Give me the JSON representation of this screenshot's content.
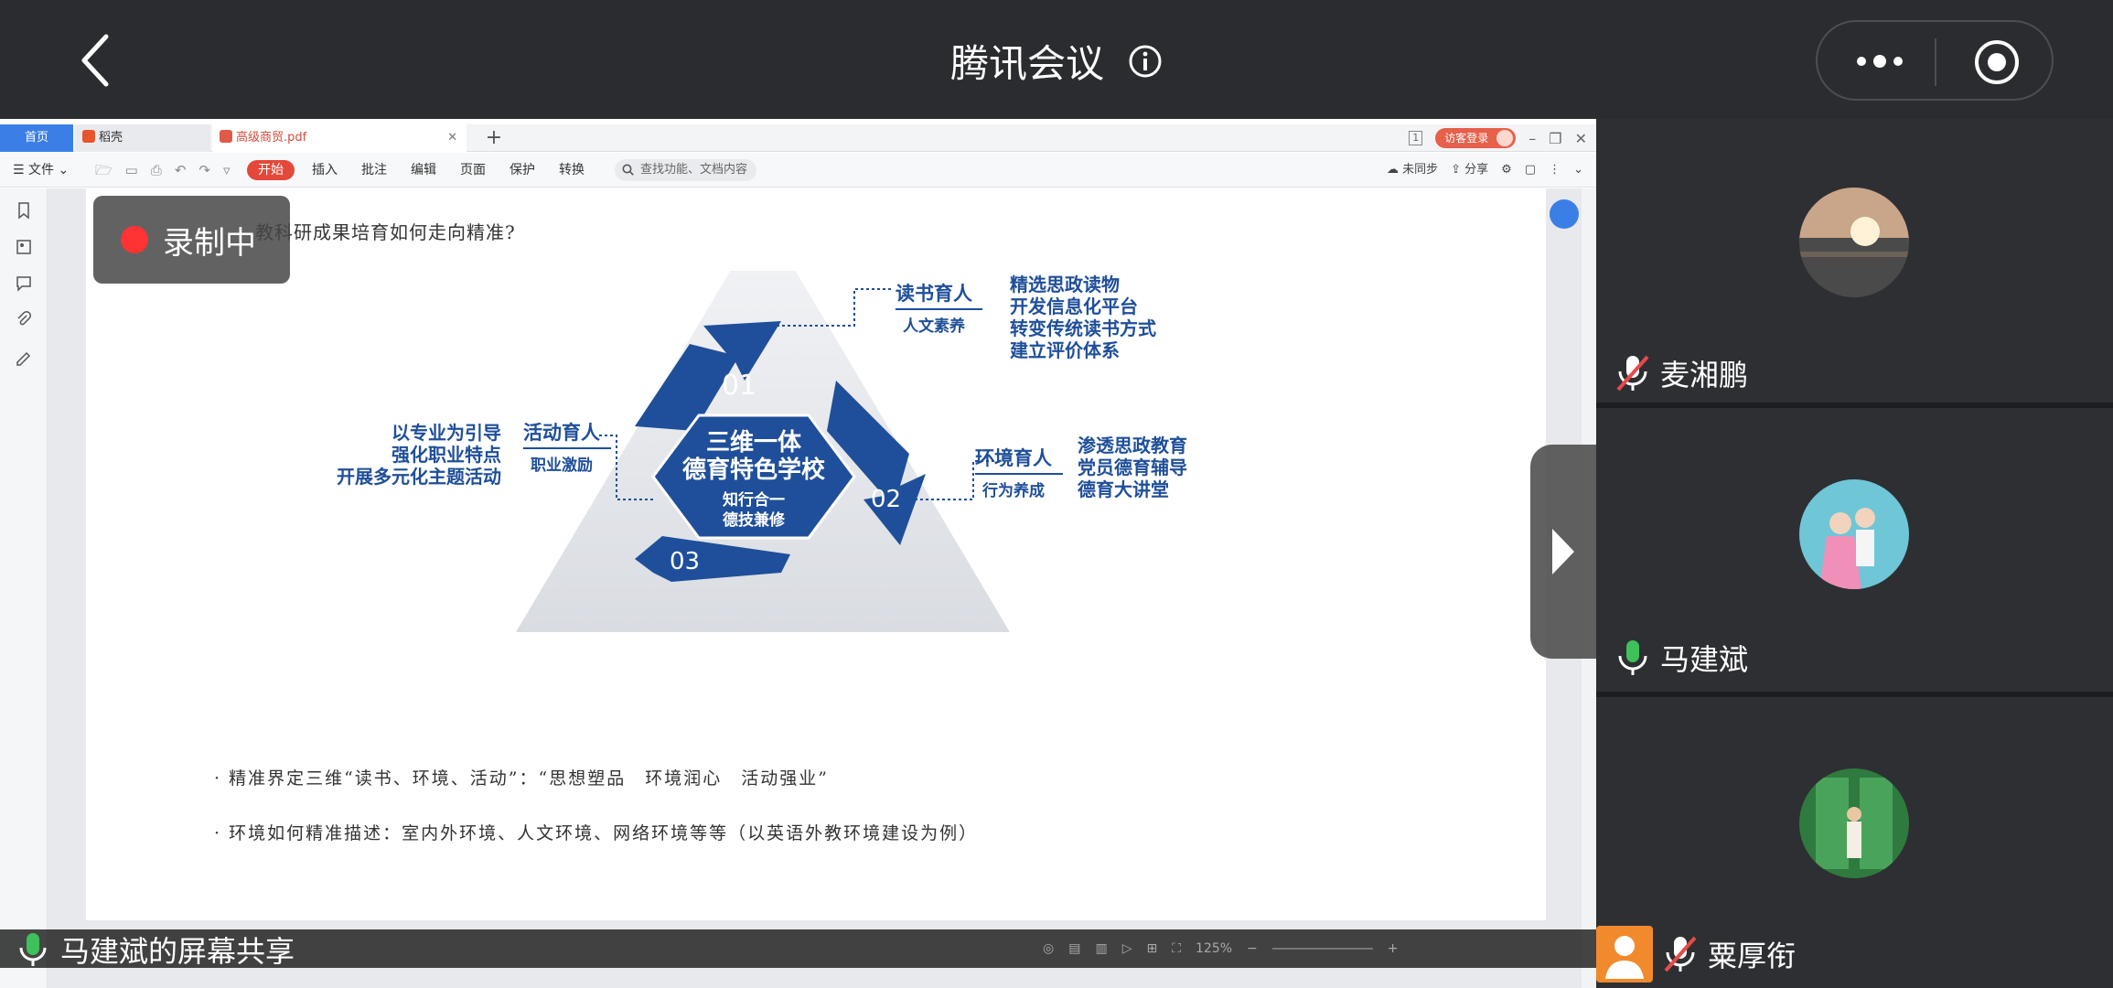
{
  "header": {
    "title": "腾讯会议"
  },
  "wps": {
    "tabs": {
      "home": "首页",
      "docer": "稻壳",
      "pdf": "高级商贸.pdf",
      "add": "+"
    },
    "page_indicator": "1",
    "login": "访客登录",
    "toolbar": {
      "file": "文件",
      "menu": [
        "开始",
        "插入",
        "批注",
        "编辑",
        "页面",
        "保护",
        "转换"
      ],
      "search_placeholder": "查找功能、文档内容",
      "sync": "未同步",
      "share": "分享"
    }
  },
  "document": {
    "title_visible": "教科研成果培育如何走向精准?",
    "diagram": {
      "center_line1": "三维一体",
      "center_line2": "德育特色学校",
      "center_sub1": "知行合一",
      "center_sub2": "德技兼修",
      "n1": "01",
      "n2": "02",
      "n3": "03",
      "read_title": "读书育人",
      "read_sub": "人文素养",
      "read_items": [
        "精选思政读物",
        "开发信息化平台",
        "转变传统读书方式",
        "建立评价体系"
      ],
      "env_title": "环境育人",
      "env_sub": "行为养成",
      "env_items": [
        "渗透思政教育",
        "党员德育辅导",
        "德育大讲堂"
      ],
      "act_title": "活动育人",
      "act_sub": "职业激励",
      "act_items": [
        "以专业为引导",
        "强化职业特点",
        "开展多元化主题活动"
      ]
    },
    "bullets": [
      "· 精准界定三维“读书、环境、活动”：“思想塑品　环境润心　活动强业”",
      "· 环境如何精准描述：室内外环境、人文环境、网络环境等等（以英语外教环境建设为例）"
    ],
    "zoom": "125%"
  },
  "recording": {
    "label": "录制中"
  },
  "share": {
    "label": "马建斌的屏幕共享"
  },
  "participants": [
    {
      "name": "麦湘鹏",
      "mic": "muted"
    },
    {
      "name": "马建斌",
      "mic": "on"
    },
    {
      "name": "粟厚衔",
      "mic": "muted"
    }
  ],
  "colors": {
    "background": "#2b2c2f",
    "accent_green": "#3ec15a",
    "muted_red": "#e84a4a",
    "diagram_blue": "#1f4f9a",
    "record_red": "#ff3333"
  }
}
